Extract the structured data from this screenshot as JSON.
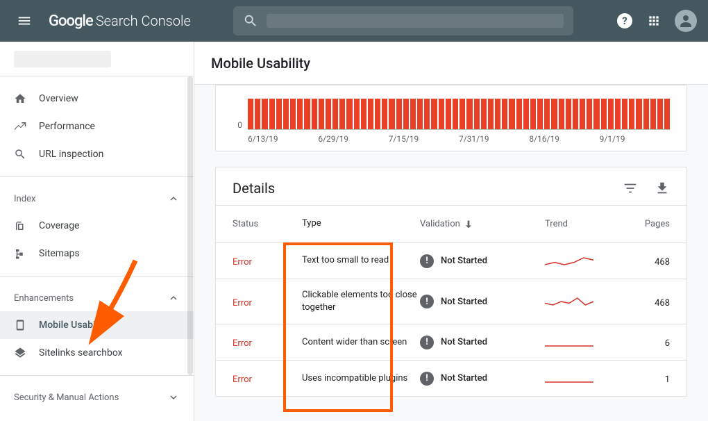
{
  "header": {
    "logo_google": "Google",
    "logo_product": "Search Console"
  },
  "sidebar": {
    "items_top": [
      {
        "icon": "home",
        "label": "Overview"
      },
      {
        "icon": "trend",
        "label": "Performance"
      },
      {
        "icon": "search",
        "label": "URL inspection"
      }
    ],
    "section_index": {
      "title": "Index",
      "items": [
        {
          "icon": "coverage",
          "label": "Coverage"
        },
        {
          "icon": "sitemap",
          "label": "Sitemaps"
        }
      ]
    },
    "section_enh": {
      "title": "Enhancements",
      "items": [
        {
          "icon": "mobile",
          "label": "Mobile Usability",
          "selected": true
        },
        {
          "icon": "layers",
          "label": "Sitelinks searchbox"
        }
      ]
    },
    "section_sec": {
      "title": "Security & Manual Actions"
    }
  },
  "page_title": "Mobile Usability",
  "chart_data": {
    "type": "bar",
    "categories": [
      "6/13/19",
      "6/29/19",
      "7/15/19",
      "7/31/19",
      "8/16/19",
      "9/1/19"
    ],
    "y_tick": 0,
    "bar_count": 60,
    "color": "#eb4025",
    "ylabel": "",
    "xlabel": ""
  },
  "details": {
    "title": "Details",
    "columns": {
      "status": "Status",
      "type": "Type",
      "validation": "Validation",
      "trend": "Trend",
      "pages": "Pages"
    },
    "rows": [
      {
        "status": "Error",
        "type": "Text too small to read",
        "validation": "Not Started",
        "pages": "468",
        "spark": [
          0,
          1,
          0,
          1,
          3,
          2
        ]
      },
      {
        "status": "Error",
        "type": "Clickable elements too close together",
        "validation": "Not Started",
        "pages": "468",
        "spark": [
          1,
          0,
          2,
          1,
          4,
          0,
          2
        ]
      },
      {
        "status": "Error",
        "type": "Content wider than screen",
        "validation": "Not Started",
        "pages": "6",
        "spark": [
          0,
          0,
          0,
          0,
          0,
          0
        ]
      },
      {
        "status": "Error",
        "type": "Uses incompatible plugins",
        "validation": "Not Started",
        "pages": "1",
        "spark": [
          0,
          0,
          0,
          0,
          0,
          0
        ]
      }
    ]
  }
}
